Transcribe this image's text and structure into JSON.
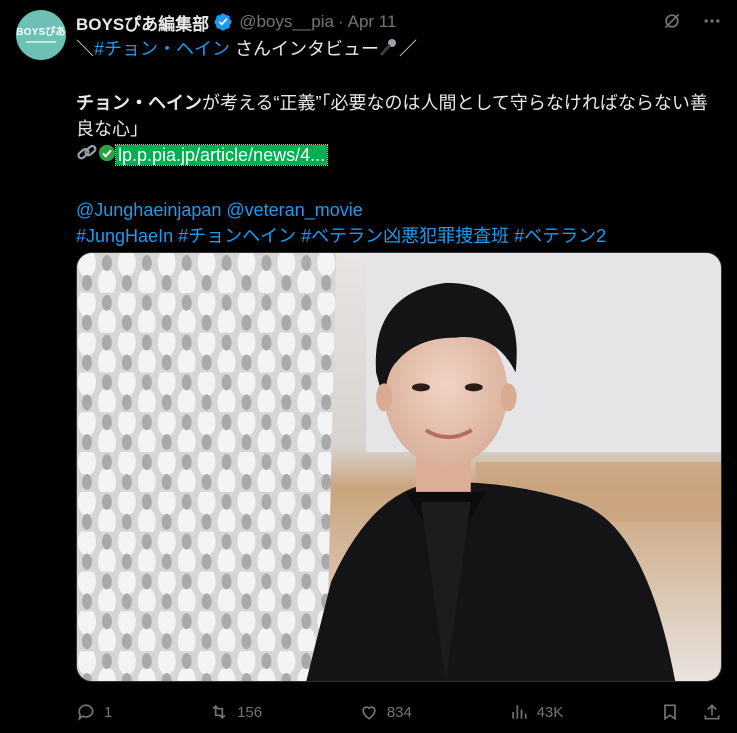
{
  "account": {
    "display_name": "BOYSぴあ編集部",
    "handle": "@boys__pia",
    "separator": "·",
    "date": "Apr 11",
    "avatar_text": "BOYSぴあ"
  },
  "body": {
    "line1_prefix": "＼",
    "line1_hashtag": "#チョン・ヘイン",
    "line1_suffix": " さんインタビュー",
    "line1_end": "／",
    "headline_bold": "チョン・ヘイン",
    "headline_rest": "が考える“正義”「必要なのは人間として守らなければならない善良な心」",
    "url": "lp.p.pia.jp/article/news/4...",
    "mentions": "@Junghaeinjapan @veteran_movie",
    "hashtags": "#JungHaeIn #チョンヘイン #ベテラン凶悪犯罪捜査班 #ベテラン2"
  },
  "actions": {
    "replies": "1",
    "reposts": "156",
    "likes": "834",
    "views": "43K"
  },
  "colors": {
    "background": "#000000",
    "text": "#e7e9ea",
    "muted": "#71767b",
    "link": "#1d9bf0",
    "verified": "#1d9bf0",
    "avatar": "#6cc0b4",
    "url_highlight": "#00b050"
  },
  "icons": {
    "verified": "verified-badge-icon",
    "grok": "grok-icon",
    "more": "more-icon",
    "link": "link-emoji-icon",
    "check": "check-emoji-icon",
    "mic": "microphone-emoji-icon",
    "reply": "reply-icon",
    "repost": "repost-icon",
    "like": "like-icon",
    "views": "views-icon",
    "bookmark": "bookmark-icon",
    "share": "share-icon"
  }
}
